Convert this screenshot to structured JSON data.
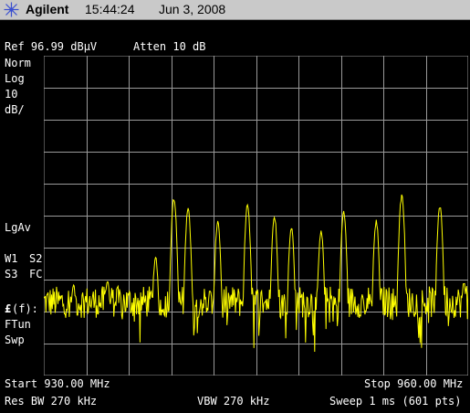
{
  "header": {
    "brand": "Agilent",
    "time": "15:44:24",
    "date": "Jun 3, 2008",
    "logo_icon": "agilent-spark-icon"
  },
  "top_readout": {
    "ref_level": "Ref 96.99 dBµV",
    "attenuation": "Atten 10 dB"
  },
  "left_annotations": {
    "detector_mode": "Norm",
    "scale_type": "Log",
    "scale_value": "10",
    "scale_unit": "dB/",
    "averaging": "LgAv",
    "w1": "W1",
    "s2": "S2",
    "s3": "S3",
    "fc": "FC",
    "func_symbol": "£",
    "func_label": "(f):",
    "ftun": "FTun",
    "swp": "Swp"
  },
  "bottom_readout": {
    "start": "Start 930.00 MHz",
    "stop": "Stop 960.00 MHz",
    "res_bw": "Res BW 270 kHz",
    "vbw": "VBW 270 kHz",
    "sweep": "Sweep 1 ms (601 pts)"
  },
  "colors": {
    "background": "#000000",
    "grid": "#9a9a9a",
    "trace": "#ffff00",
    "text": "#ffffff",
    "titlebar": "#c9c9c9"
  },
  "chart_data": {
    "type": "line",
    "x_unit": "MHz",
    "y_unit": "dBµV",
    "xlim": [
      930,
      960
    ],
    "ylim": [
      -3.01,
      96.99
    ],
    "grid": true,
    "points": 601,
    "noise_floor_dBuV": 20,
    "peaks": [
      {
        "freq_mhz": 932.1,
        "level_dbuv": 25
      },
      {
        "freq_mhz": 934.5,
        "level_dbuv": 27
      },
      {
        "freq_mhz": 937.9,
        "level_dbuv": 34
      },
      {
        "freq_mhz": 939.2,
        "level_dbuv": 52
      },
      {
        "freq_mhz": 940.2,
        "level_dbuv": 49
      },
      {
        "freq_mhz": 942.3,
        "level_dbuv": 45
      },
      {
        "freq_mhz": 944.4,
        "level_dbuv": 50
      },
      {
        "freq_mhz": 946.3,
        "level_dbuv": 47
      },
      {
        "freq_mhz": 947.5,
        "level_dbuv": 43
      },
      {
        "freq_mhz": 949.6,
        "level_dbuv": 42
      },
      {
        "freq_mhz": 951.2,
        "level_dbuv": 48
      },
      {
        "freq_mhz": 953.5,
        "level_dbuv": 45
      },
      {
        "freq_mhz": 955.3,
        "level_dbuv": 53
      },
      {
        "freq_mhz": 958.0,
        "level_dbuv": 50
      },
      {
        "freq_mhz": 959.7,
        "level_dbuv": 26
      }
    ]
  }
}
